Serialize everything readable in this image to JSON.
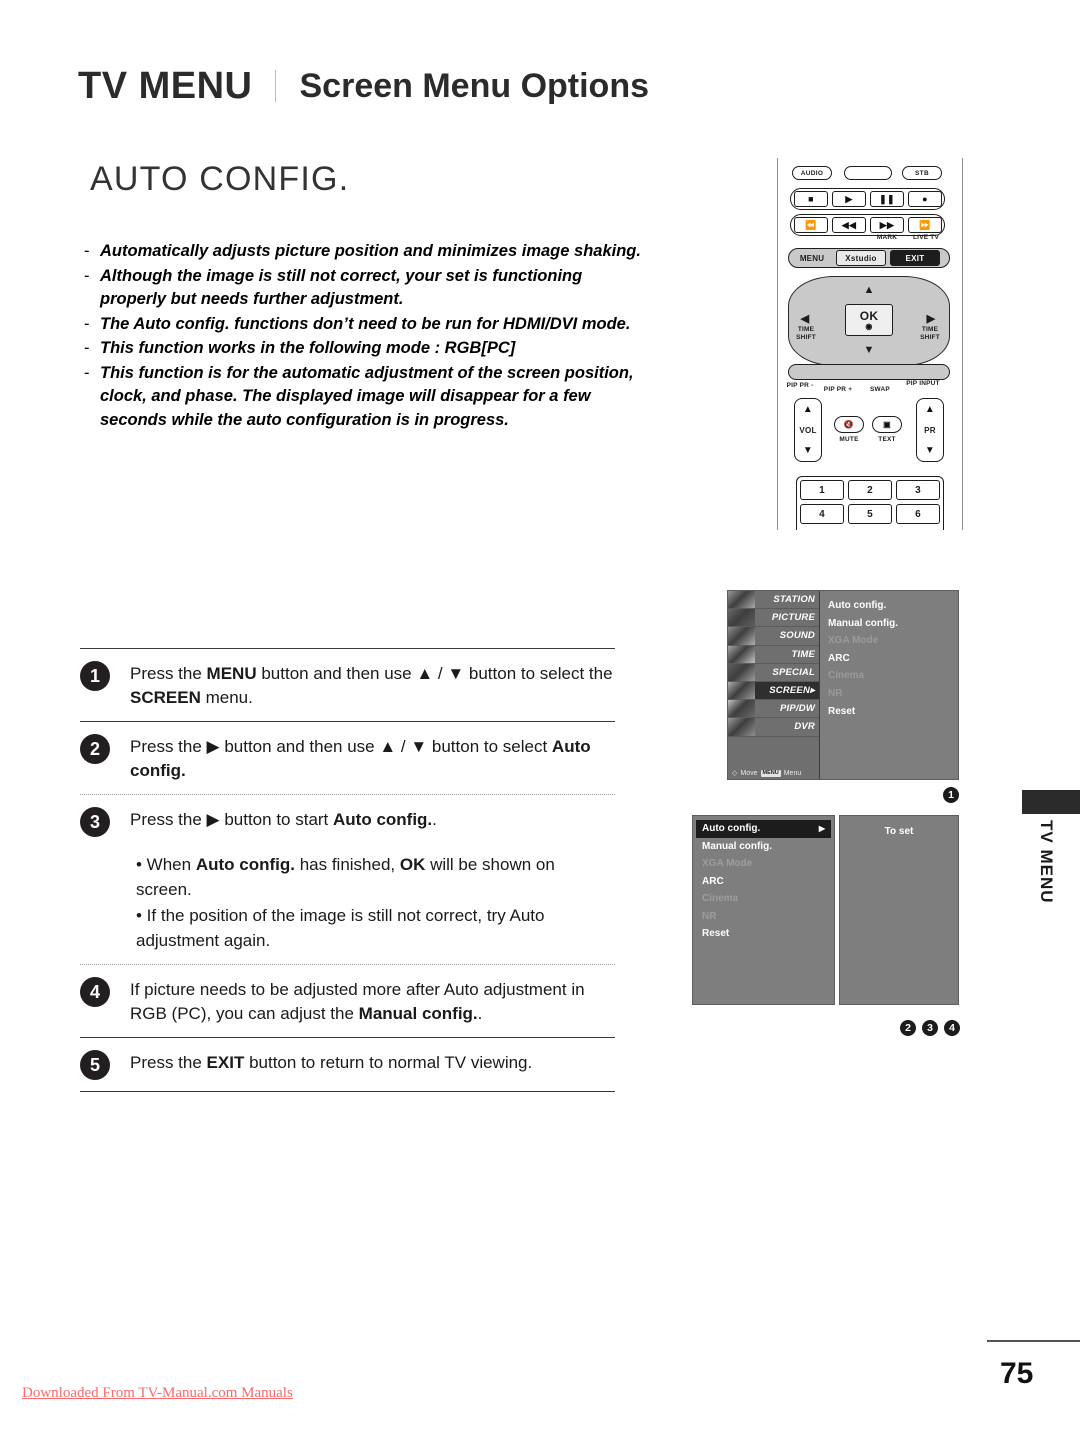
{
  "header": {
    "main_title": "TV MENU",
    "separator": "|",
    "sub_title": "Screen Menu Options"
  },
  "page_title": "AUTO CONFIG.",
  "description": {
    "dash": "-",
    "items": [
      {
        "pre": "",
        "bold": "",
        "post": "Automatically adjusts picture position and minimizes image shaking."
      },
      {
        "pre": "",
        "bold": "",
        "post": "Although the image is still not correct, your set is functioning properly but needs further adjustment."
      },
      {
        "pre": "The ",
        "bold": "Auto config.",
        "post": " functions don’t need to be run for HDMI/DVI mode."
      },
      {
        "pre": "",
        "bold": "",
        "post": "This function works in the following mode : RGB[PC]"
      },
      {
        "pre": "",
        "bold": "",
        "post": "This function is for the automatic adjustment of the screen position, clock, and phase. The displayed image will disappear for a few seconds while the auto configuration is in progress."
      }
    ]
  },
  "steps": [
    {
      "number": "1",
      "parts": [
        {
          "t": "Press the "
        },
        {
          "t": "MENU",
          "b": true
        },
        {
          "t": " button and then use ▲ / ▼ button to select the "
        },
        {
          "t": "SCREEN",
          "b": true
        },
        {
          "t": " menu."
        }
      ]
    },
    {
      "number": "2",
      "parts": [
        {
          "t": "Press the ▶ button and then use ▲ / ▼ button to select "
        },
        {
          "t": "Auto config.",
          "b": true
        }
      ]
    },
    {
      "number": "3",
      "parts": [
        {
          "t": "Press the ▶ button to start "
        },
        {
          "t": "Auto config.",
          "b": true
        },
        {
          "t": "."
        }
      ]
    },
    {
      "number": "4",
      "parts": [
        {
          "t": "If picture needs to be adjusted more after Auto adjustment in RGB (PC), you can adjust the "
        },
        {
          "t": "Manual config.",
          "b": true
        },
        {
          "t": "."
        }
      ]
    },
    {
      "number": "5",
      "parts": [
        {
          "t": "Press the "
        },
        {
          "t": "EXIT",
          "b": true
        },
        {
          "t": " button to return to normal TV viewing."
        }
      ]
    }
  ],
  "bullets": [
    [
      {
        "t": "• When "
      },
      {
        "t": "Auto config.",
        "b": true
      },
      {
        "t": " has finished, "
      },
      {
        "t": "OK",
        "b": true
      },
      {
        "t": " will be shown on screen."
      }
    ],
    [
      {
        "t": "• If the position of the image is still not correct, try Auto adjustment again."
      }
    ]
  ],
  "remote": {
    "top_buttons": [
      {
        "name": "AUDIO"
      },
      {
        "name": ""
      },
      {
        "name": "STB"
      }
    ],
    "transport_row1": [
      {
        "glyph": "■",
        "name": "stop-button"
      },
      {
        "glyph": "▶",
        "name": "play-button"
      },
      {
        "glyph": "‖",
        "name": "pause-button"
      },
      {
        "glyph": "●",
        "name": "record-button"
      }
    ],
    "transport_row2": [
      {
        "glyph": "⏮",
        "name": "rewind-to-start-button",
        "label": ""
      },
      {
        "glyph": "⏪",
        "name": "rewind-button",
        "label": ""
      },
      {
        "glyph": "⏩",
        "name": "fast-forward-button",
        "label": "MARK"
      },
      {
        "glyph": "⏭",
        "name": "skip-forward-button",
        "label": "LIVE TV"
      }
    ],
    "menu_row": [
      {
        "label": "MENU"
      },
      {
        "label": "Xstudio"
      },
      {
        "label": "EXIT"
      }
    ],
    "dpad": {
      "up": "▲",
      "down": "▼",
      "left": "◀",
      "right": "▶",
      "ok": "OK",
      "left_label": "TIME SHIFT",
      "right_label": "TIME SHIFT"
    },
    "pip_labels": [
      "PIP PR -",
      "PIP PR +",
      "SWAP",
      "PIP INPUT"
    ],
    "vol_label": "VOL",
    "pr_label": "PR",
    "mute_label": "MUTE",
    "text_label": "TEXT",
    "numpad": [
      "1",
      "2",
      "3",
      "4",
      "5",
      "6"
    ]
  },
  "osd_main": {
    "menu_items": [
      {
        "label": "STATION",
        "selected": false
      },
      {
        "label": "PICTURE",
        "selected": false
      },
      {
        "label": "SOUND",
        "selected": false
      },
      {
        "label": "TIME",
        "selected": false
      },
      {
        "label": "SPECIAL",
        "selected": false
      },
      {
        "label": "SCREEN▸",
        "selected": true
      },
      {
        "label": "PIP/DW",
        "selected": false
      },
      {
        "label": "DVR",
        "selected": false
      }
    ],
    "options": [
      {
        "label": "Auto config.",
        "dim": false
      },
      {
        "label": "Manual config.",
        "dim": false
      },
      {
        "label": "XGA Mode",
        "dim": true
      },
      {
        "label": "ARC",
        "dim": false
      },
      {
        "label": "Cinema",
        "dim": true
      },
      {
        "label": "NR",
        "dim": true
      },
      {
        "label": "Reset",
        "dim": false
      }
    ],
    "footer": {
      "move_icon": "◇",
      "move_label": "Move",
      "menu_key": "MENU",
      "menu_label": "Menu"
    }
  },
  "osd_sub": {
    "options": [
      {
        "label": "Auto config.",
        "dim": false,
        "highlight": true,
        "arrow": "▶"
      },
      {
        "label": "Manual config.",
        "dim": false,
        "highlight": false,
        "arrow": ""
      },
      {
        "label": "XGA Mode",
        "dim": true,
        "highlight": false,
        "arrow": ""
      },
      {
        "label": "ARC",
        "dim": false,
        "highlight": false,
        "arrow": ""
      },
      {
        "label": "Cinema",
        "dim": true,
        "highlight": false,
        "arrow": ""
      },
      {
        "label": "NR",
        "dim": true,
        "highlight": false,
        "arrow": ""
      },
      {
        "label": "Reset",
        "dim": false,
        "highlight": false,
        "arrow": ""
      }
    ],
    "to_set": "To set"
  },
  "callouts": {
    "single": "1",
    "group": [
      "2",
      "3",
      "4"
    ]
  },
  "side_tab": {
    "label": "TV MENU"
  },
  "footer": {
    "page_number": "75",
    "download_note": "Downloaded From TV-Manual.com Manuals"
  },
  "colors": {
    "accent_red": "#fb6a6a",
    "osd_gray": "#7e7e7e",
    "dark": "#231f20"
  }
}
